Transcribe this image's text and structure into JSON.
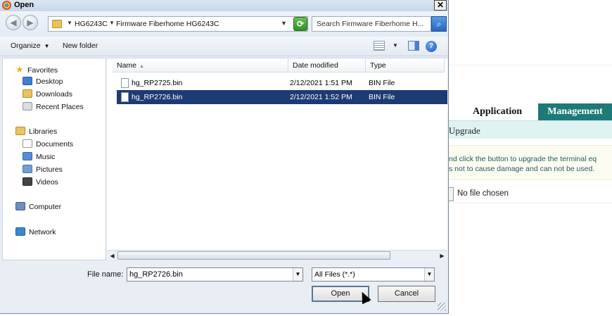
{
  "dialog": {
    "title": "Open",
    "close_label": "✕",
    "breadcrumb": [
      "HG6243C",
      "Firmware Fiberhome HG6243C"
    ],
    "search_placeholder": "Search Firmware Fiberhome H...",
    "toolbar": {
      "organize_label": "Organize",
      "new_folder_label": "New folder"
    },
    "nav": {
      "favorites": {
        "label": "Favorites",
        "items": [
          {
            "label": "Desktop",
            "icon": "desktop-icon"
          },
          {
            "label": "Downloads",
            "icon": "downloads-icon"
          },
          {
            "label": "Recent Places",
            "icon": "recent-places-icon"
          }
        ]
      },
      "libraries": {
        "label": "Libraries",
        "items": [
          {
            "label": "Documents",
            "icon": "documents-icon"
          },
          {
            "label": "Music",
            "icon": "music-icon"
          },
          {
            "label": "Pictures",
            "icon": "pictures-icon"
          },
          {
            "label": "Videos",
            "icon": "videos-icon"
          }
        ]
      },
      "computer_label": "Computer",
      "network_label": "Network"
    },
    "columns": {
      "name": "Name",
      "date": "Date modified",
      "type": "Type"
    },
    "files": [
      {
        "name": "hg_RP2725.bin",
        "date": "2/12/2021 1:51 PM",
        "type": "BIN File",
        "selected": false
      },
      {
        "name": "hg_RP2726.bin",
        "date": "2/12/2021 1:52 PM",
        "type": "BIN File",
        "selected": true
      }
    ],
    "file_name_label": "File name:",
    "file_name_value": "hg_RP2726.bin",
    "file_type_value": "All Files (*.*)",
    "open_label": "Open",
    "cancel_label": "Cancel"
  },
  "background_page": {
    "tabs": [
      "Application",
      "Management"
    ],
    "section_title": "Upgrade",
    "description_lines": [
      "nd click the button to upgrade the terminal eq",
      "s not to cause damage and can not be used."
    ],
    "file_status": "No file chosen",
    "colors": {
      "active_tab": "#1c7a77",
      "section_bg": "#dff3f3",
      "selection": "#1d3b73"
    }
  }
}
